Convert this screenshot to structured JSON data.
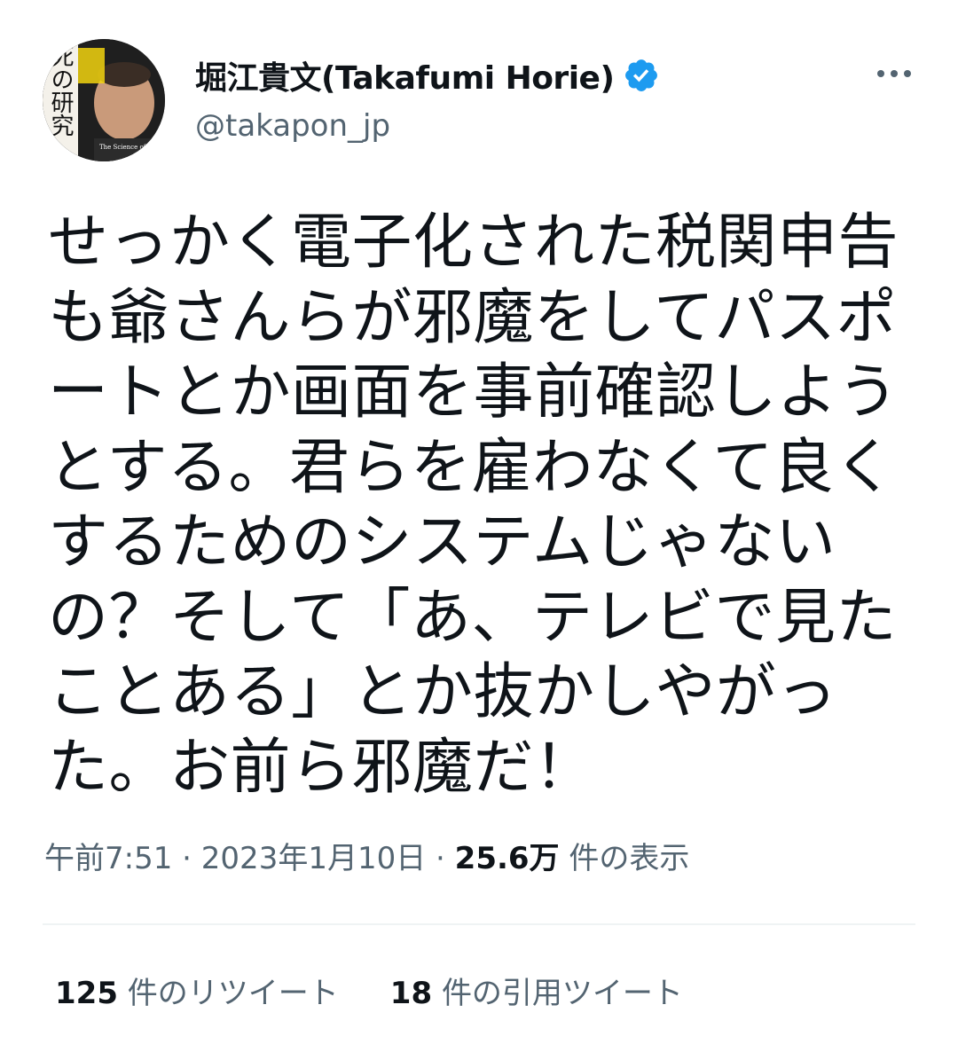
{
  "author": {
    "display_name": "堀江貴文(Takafumi Horie)",
    "handle": "@takapon_jp",
    "avatar_book_title": "不死の研究",
    "avatar_book_subtitle": "The Science of Immortality",
    "verified": true
  },
  "tweet": {
    "text": "せっかく電子化された税関申告も爺さんらが邪魔をしてパスポートとか画面を事前確認しようとする。君らを雇わなくて良くするためのシステムじゃないの？そして「あ、テレビで見たことある」とか抜かしやがった。お前ら邪魔だ！",
    "time": "午前7:51",
    "date": "2023年1月10日",
    "views_count": "25.6万",
    "views_label": "件の表示",
    "separator": "·"
  },
  "stats": {
    "retweets_count": "125",
    "retweets_label": "件のリツイート",
    "quotes_count": "18",
    "quotes_label": "件の引用ツイート"
  },
  "icons": {
    "verified_badge": "verified-badge-icon",
    "more": "more-horizontal-icon"
  },
  "colors": {
    "verified": "#1d9bf0",
    "text_primary": "#0f1419",
    "text_secondary": "#536471",
    "divider": "#eff3f4"
  }
}
